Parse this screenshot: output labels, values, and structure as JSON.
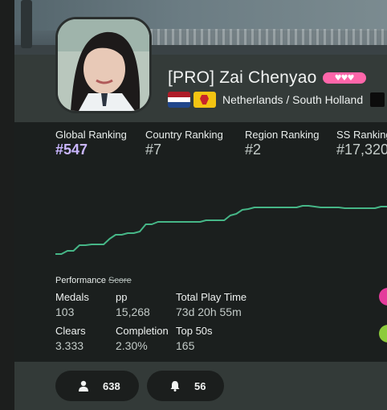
{
  "profile": {
    "title_prefix": "[PRO]",
    "username": "Zai Chenyao",
    "supporter_badge": "♥♥♥",
    "country_flag_colors": [
      "#ae1c28",
      "#ffffff",
      "#21468b"
    ],
    "region_flag_colors": [
      "#f3c412",
      "#c8242b"
    ],
    "location": "Netherlands / South Holland"
  },
  "rankings": [
    {
      "label": "Global Ranking",
      "value": "#547"
    },
    {
      "label": "Country Ranking",
      "value": "#7"
    },
    {
      "label": "Region Ranking",
      "value": "#2"
    },
    {
      "label": "SS Ranking",
      "value": "#17,320"
    }
  ],
  "chart_data": {
    "type": "line",
    "series": [
      {
        "y": [
          96,
          96,
          92,
          92,
          85,
          85,
          84,
          84,
          84,
          77,
          72,
          72,
          70,
          70,
          68,
          59,
          59,
          56,
          56,
          56,
          56,
          56,
          56,
          56,
          56,
          54,
          54,
          54,
          54,
          48,
          46,
          41,
          40,
          38,
          38,
          38,
          38,
          38,
          38,
          38,
          38,
          36,
          36,
          37,
          38,
          38,
          38,
          38,
          39,
          39,
          39,
          39,
          39,
          39,
          37,
          37
        ]
      }
    ],
    "color": "#46b687",
    "grid": false,
    "legend": "none",
    "ylim": [
      0,
      100
    ]
  },
  "stats": {
    "performance_label": "Performance",
    "score_label": "Score",
    "medals_label": "Medals",
    "medals_value": "103",
    "pp_label": "pp",
    "pp_value": "15,268",
    "play_time_label": "Total Play Time",
    "play_time_value": "73d 20h 55m",
    "clears_label": "Clears",
    "clears_value": "3.333",
    "completion_label": "Completion",
    "completion_value": "2.30%",
    "top50_label": "Top 50s",
    "top50_value": "165"
  },
  "social": {
    "followers_icon": "user-icon",
    "followers_count": "638",
    "subscribers_icon": "bell-icon",
    "subscribers_count": "56"
  }
}
